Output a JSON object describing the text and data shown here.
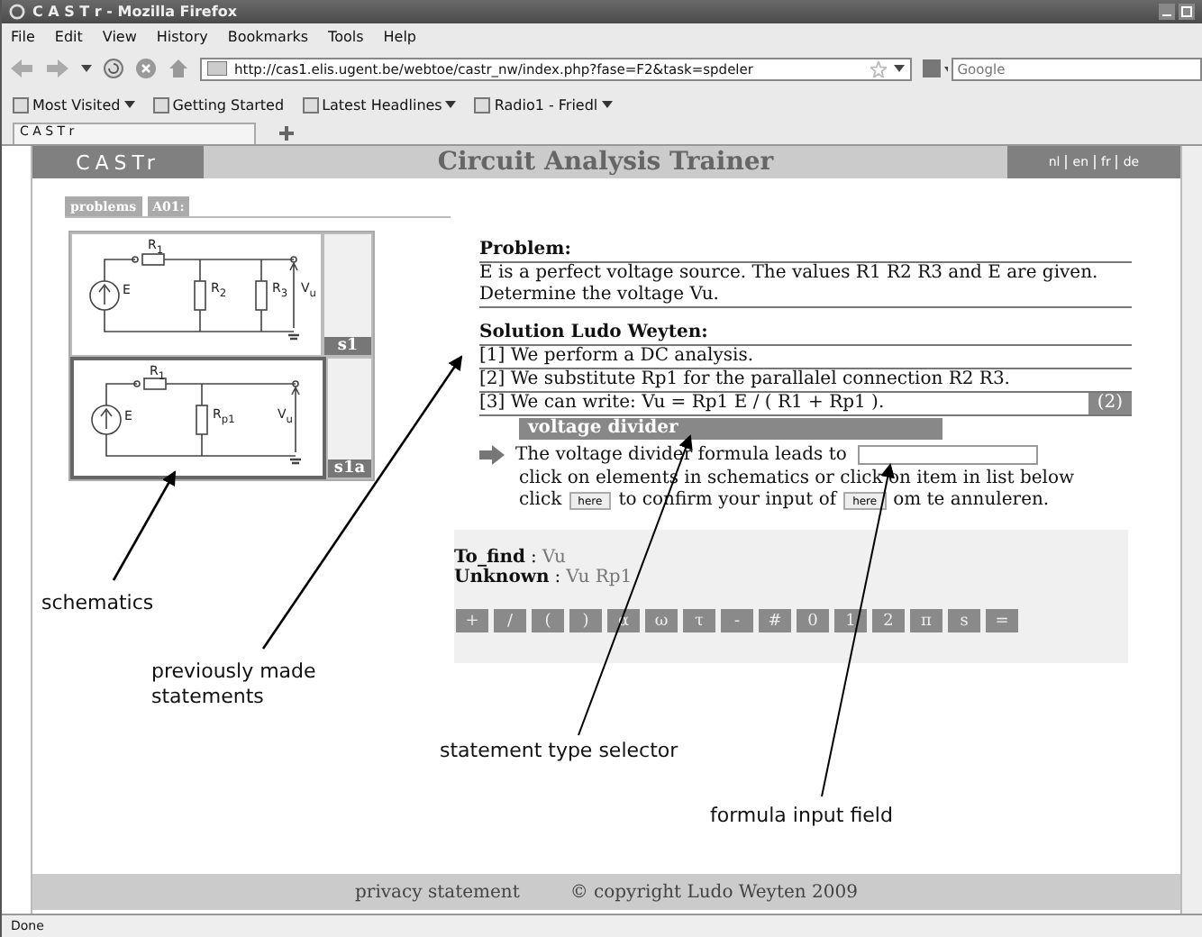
{
  "window": {
    "title": "C A S T r - Mozilla Firefox"
  },
  "menu": [
    "File",
    "Edit",
    "View",
    "History",
    "Bookmarks",
    "Tools",
    "Help"
  ],
  "toolbar": {
    "url": "http://cas1.elis.ugent.be/webtoe/castr_nw/index.php?fase=F2&task=spdeler",
    "search_placeholder": "Google"
  },
  "bookmarks": [
    {
      "label": "Most Visited",
      "dropdown": true
    },
    {
      "label": "Getting Started",
      "dropdown": false
    },
    {
      "label": "Latest Headlines",
      "dropdown": true
    },
    {
      "label": "Radio1 - Friedl",
      "dropdown": true
    }
  ],
  "browser_tab": "C A S T r",
  "page": {
    "logo": "CASTr",
    "title": "Circuit Analysis Trainer",
    "languages": [
      "nl",
      "en",
      "fr",
      "de"
    ],
    "tabs": [
      "problems",
      "A01:"
    ],
    "schematics": [
      {
        "kind": "three-resistor",
        "tag": "s1",
        "selected": false,
        "labels": [
          "R$_{1}$",
          "E",
          "R$_{2}$",
          "R$_{3}$",
          "V$_{u}$"
        ]
      },
      {
        "kind": "one-resistor",
        "tag": "s1a",
        "selected": true,
        "labels": [
          "R$_{1}$",
          "E",
          "R$_{p1}$",
          "V$_{u}$"
        ]
      }
    ],
    "problem": {
      "heading": "Problem:",
      "text": "E is a perfect voltage source. The values R1 R2 R3 and E are given. Determine the voltage Vu."
    },
    "solution": {
      "heading": "Solution Ludo Weyten:",
      "statements": [
        "[1] We perform a DC analysis.",
        "[2] We substitute Rp1 for the parallalel connection R2 R3.",
        "[3] We can write: Vu = Rp1 E / ( R1 + Rp1 )."
      ],
      "badge": "(2)"
    },
    "type_selector": "voltage divider",
    "prompt": {
      "text": "The voltage divider formula leads to",
      "hint": "click on elements in schematics or click on item in list below",
      "before": "click",
      "confirm_button": "here",
      "middle": "to confirm your input of",
      "cancel_button": "here",
      "after": "om te annuleren."
    },
    "variables": [
      {
        "label": "To_find",
        "separator": ":",
        "value": "Vu"
      },
      {
        "label": "Unknown",
        "separator": ":",
        "value": "Vu Rp1"
      }
    ],
    "keypad": [
      "+",
      "/",
      "(",
      ")",
      "α",
      "ω",
      "τ",
      "-",
      "#",
      "0",
      "1",
      "2",
      "π",
      "s",
      "="
    ],
    "footer": [
      "privacy statement",
      "© copyright Ludo Weyten 2009"
    ]
  },
  "status_bar": "Done",
  "annotations": [
    "schematics",
    "previously made statements",
    "statement type selector",
    "formula input field"
  ]
}
